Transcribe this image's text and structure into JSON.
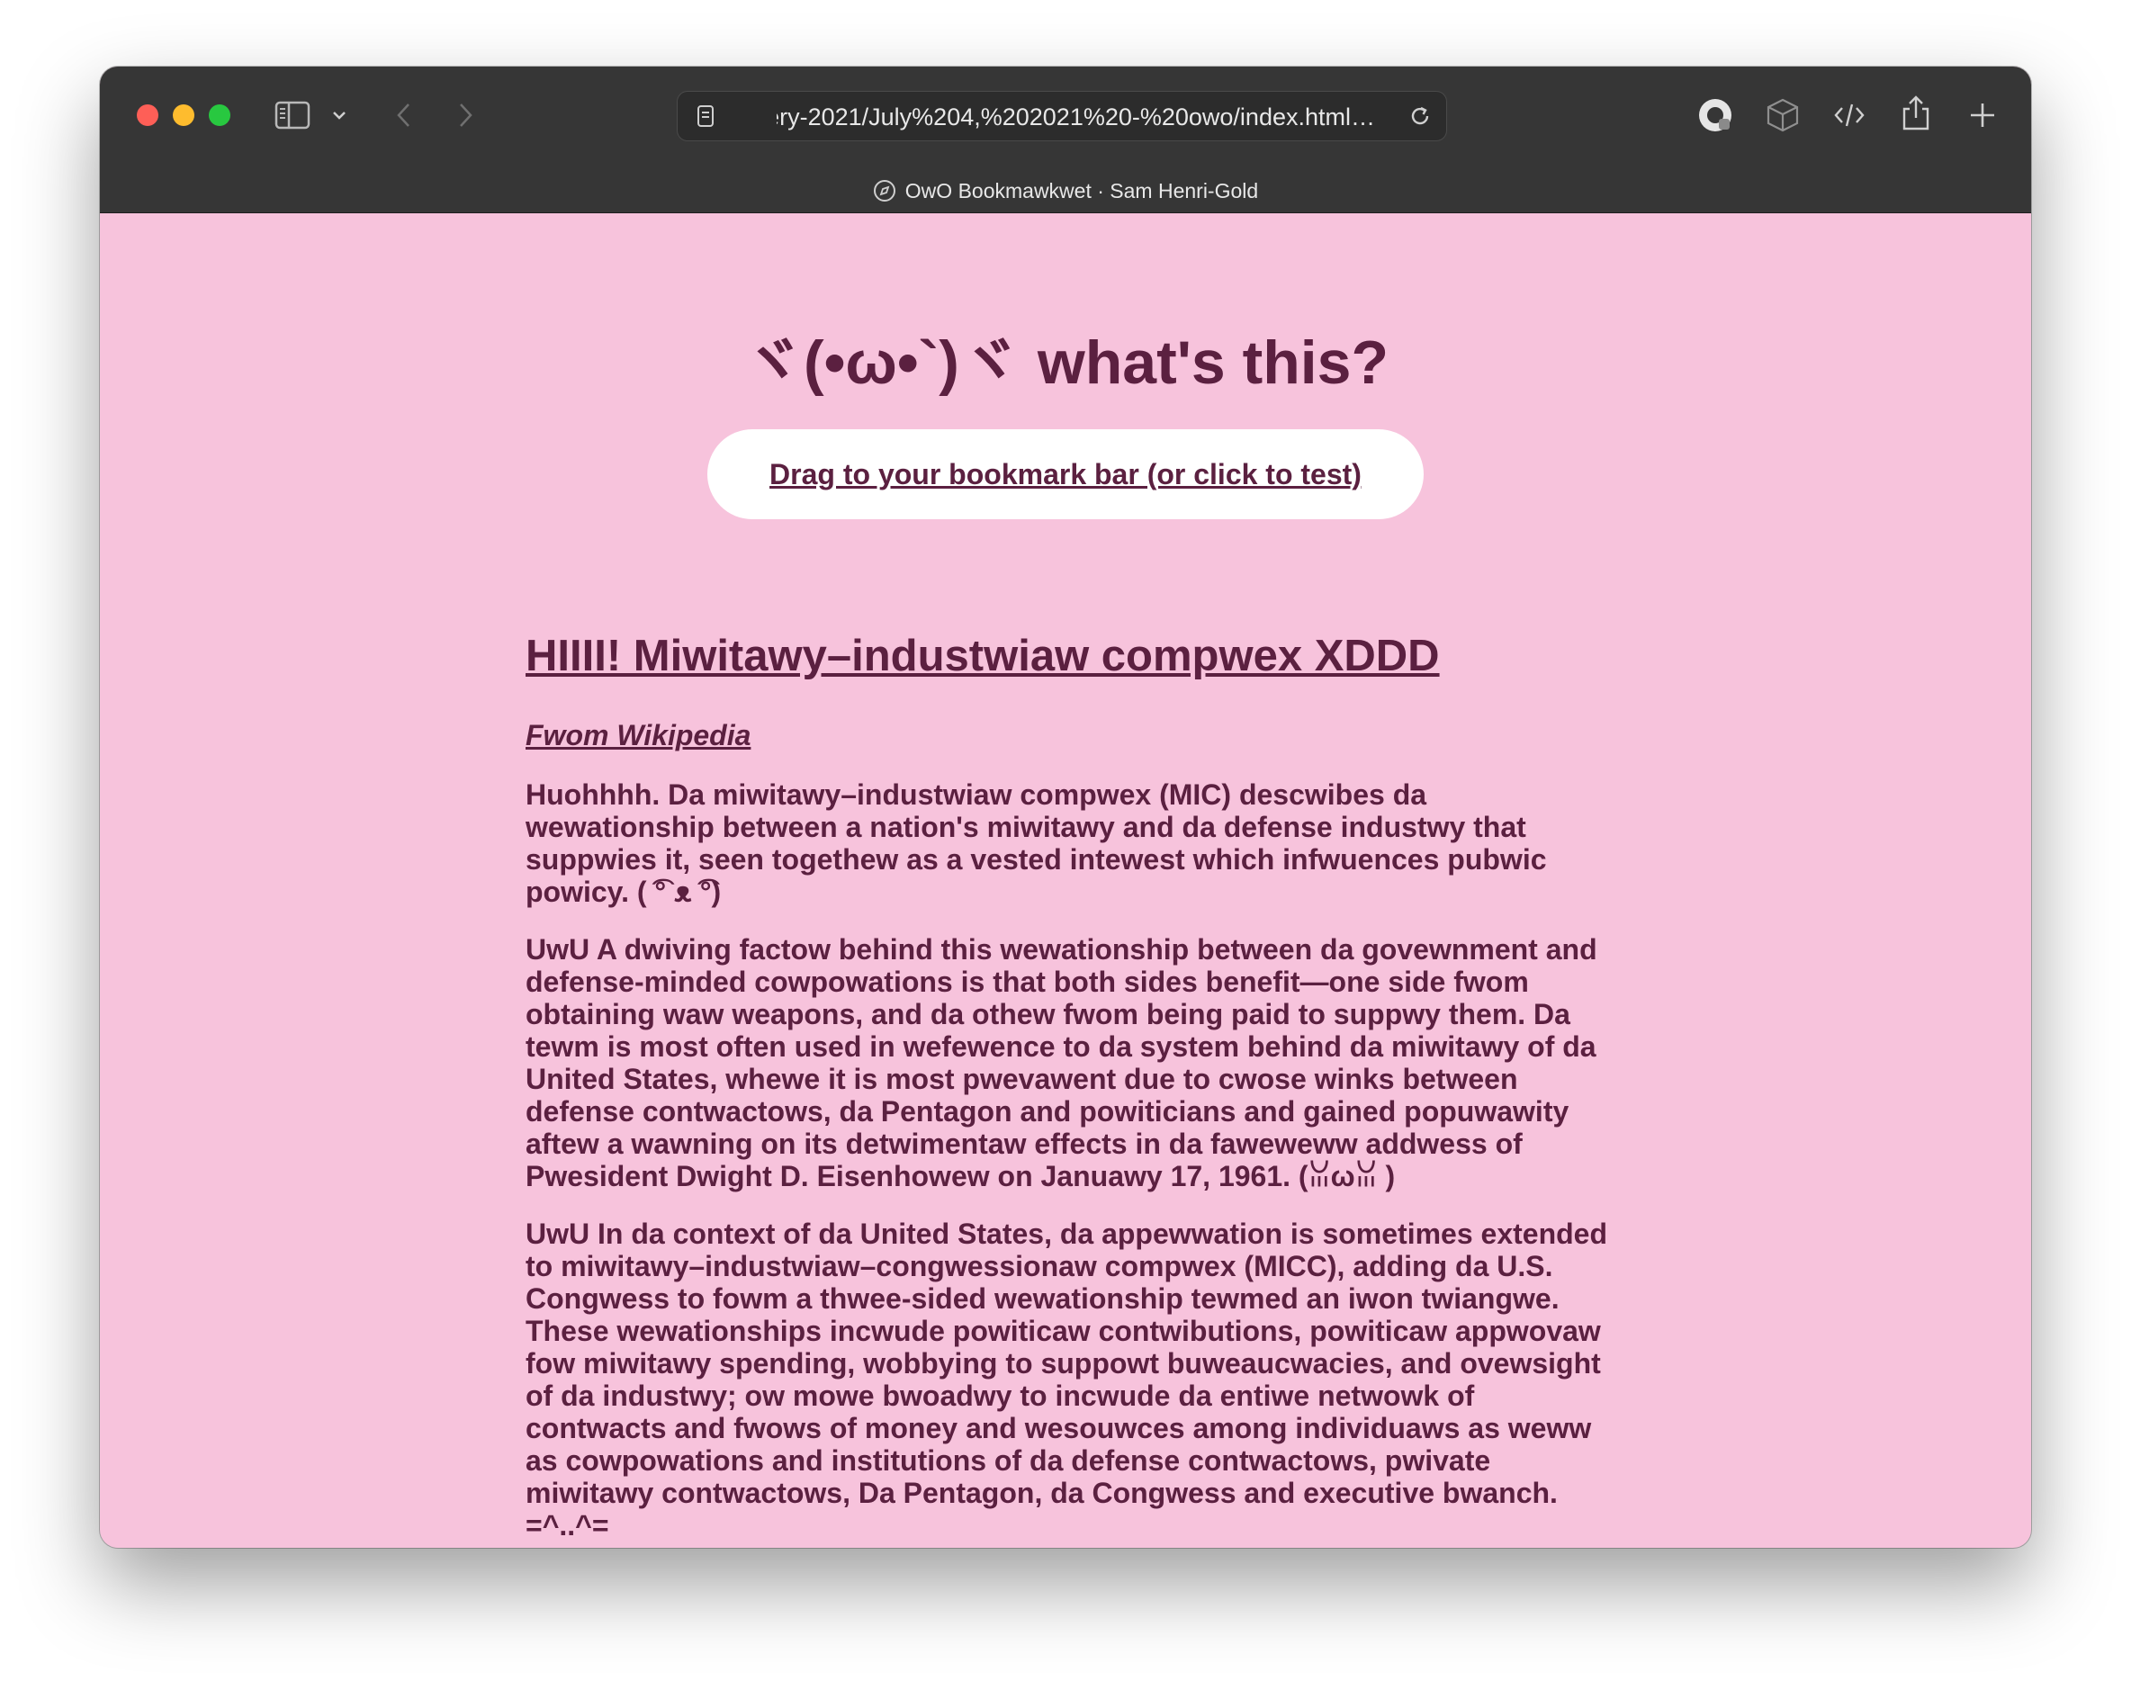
{
  "browser": {
    "url": "…lery-2021/July%204,%202021%20-%20owo/index.html",
    "tab_title": "OwO Bookmawkwet · Sam Henri-Gold"
  },
  "page": {
    "title": "ヾ(•ω•`)ヾ what's this?",
    "cta_label": "Drag to your bookmark bar (or click to test)"
  },
  "article": {
    "heading": "HIIII! Miwitawy–industwiaw compwex XDDD",
    "source": "Fwom Wikipedia",
    "paragraphs": [
      "Huohhhh. Da miwitawy–industwiaw compwex (MIC) descwibes da wewationship between a nation's miwitawy and da defense industwy that suppwies it, seen togethew as a vested intewest which infwuences pubwic powicy. ( ͡° ᴥ ͡°)",
      "UwU A dwiving factow behind this wewationship between da govewnment and defense-minded cowpowations is that both sides benefit—one side fwom obtaining waw weapons, and da othew fwom being paid to suppwy them. Da tewm is most often used in wefewence to da system behind da miwitawy of da United States, whewe it is most pwevawent due to cwose winks between defense contwactows, da Pentagon and powiticians and gained popuwawity aftew a wawning on its detwimentaw effects in da faweweww addwess of Pwesident Dwight D. Eisenhowew on Januawy 17, 1961. (ꈍωꈍ )",
      "UwU In da context of da United States, da appewwation is sometimes extended to miwitawy–industwiaw–congwessionaw compwex (MICC), adding da U.S. Congwess to fowm a thwee-sided wewationship tewmed an iwon twiangwe. These wewationships incwude powiticaw contwibutions, powiticaw appwovaw fow miwitawy spending, wobbying to suppowt buweaucwacies, and ovewsight of da industwy; ow mowe bwoadwy to incwude da entiwe netwowk of contwacts and fwows of money and wesouwces among individuaws as weww as cowpowations and institutions of da defense contwactows, pwivate miwitawy contwactows, Da Pentagon, da Congwess and executive bwanch. =^..^="
    ]
  },
  "colors": {
    "page_background": "#f7c3dc",
    "text": "#5b2040",
    "button_background": "#ffffff",
    "chrome": "#363636"
  }
}
